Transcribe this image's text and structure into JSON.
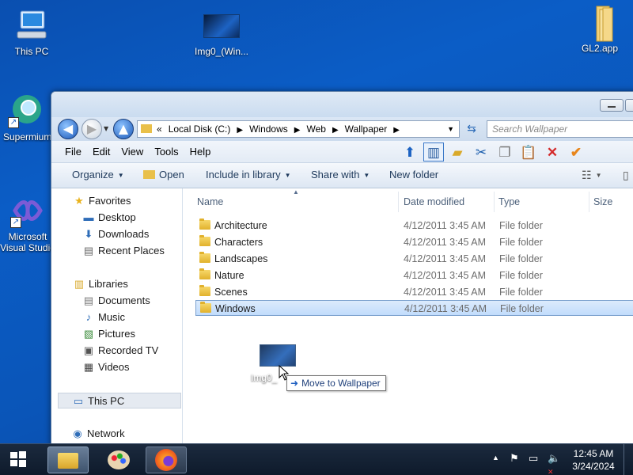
{
  "desktop": {
    "icons": [
      {
        "label": "This PC"
      },
      {
        "label": "Img0_(Win..."
      },
      {
        "label": "GL2.app"
      },
      {
        "label": "Supermium"
      },
      {
        "label": "Microsoft Visual Studio"
      }
    ]
  },
  "explorer": {
    "address": {
      "prefix": "«",
      "crumbs": [
        "Local Disk (C:)",
        "Windows",
        "Web",
        "Wallpaper"
      ]
    },
    "search_placeholder": "Search Wallpaper",
    "menu": [
      "File",
      "Edit",
      "View",
      "Tools",
      "Help"
    ],
    "commands": {
      "organize": "Organize",
      "open": "Open",
      "include": "Include in library",
      "share": "Share with",
      "new_folder": "New folder"
    },
    "nav": {
      "favorites": "Favorites",
      "desktop": "Desktop",
      "downloads": "Downloads",
      "recent": "Recent Places",
      "libraries": "Libraries",
      "documents": "Documents",
      "music": "Music",
      "pictures": "Pictures",
      "recorded_tv": "Recorded TV",
      "videos": "Videos",
      "this_pc": "This PC",
      "network": "Network"
    },
    "columns": {
      "name": "Name",
      "date": "Date modified",
      "type": "Type",
      "size": "Size"
    },
    "rows": [
      {
        "name": "Architecture",
        "date": "4/12/2011 3:45 AM",
        "type": "File folder"
      },
      {
        "name": "Characters",
        "date": "4/12/2011 3:45 AM",
        "type": "File folder"
      },
      {
        "name": "Landscapes",
        "date": "4/12/2011 3:45 AM",
        "type": "File folder"
      },
      {
        "name": "Nature",
        "date": "4/12/2011 3:45 AM",
        "type": "File folder"
      },
      {
        "name": "Scenes",
        "date": "4/12/2011 3:45 AM",
        "type": "File folder"
      },
      {
        "name": "Windows",
        "date": "4/12/2011 3:45 AM",
        "type": "File folder"
      }
    ],
    "selected_row": "Windows"
  },
  "drag": {
    "label": "Img0_",
    "tooltip_arrow": "➜",
    "tooltip": "Move to Wallpaper"
  },
  "taskbar": {
    "time": "12:45 AM",
    "date": "3/24/2024"
  }
}
